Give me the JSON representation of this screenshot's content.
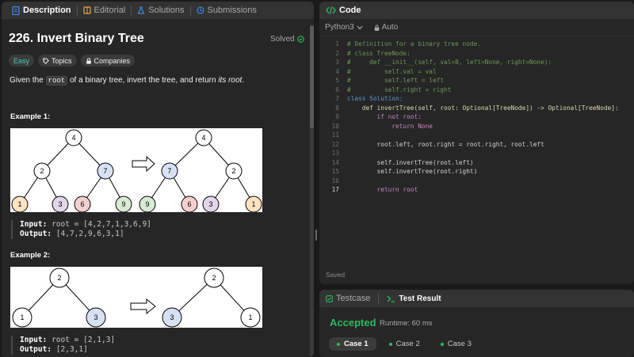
{
  "tabs": {
    "description": "Description",
    "editorial": "Editorial",
    "solutions": "Solutions",
    "submissions": "Submissions"
  },
  "problem": {
    "title": "226. Invert Binary Tree",
    "status": "Solved",
    "difficulty": "Easy",
    "topics": "Topics",
    "companies": "Companies",
    "desc_pre": "Given the ",
    "desc_code": "root",
    "desc_mid": " of a binary tree, invert the tree, and return ",
    "desc_em": "its root",
    "desc_post": "."
  },
  "examples": [
    {
      "title": "Example 1:",
      "input_label": "Input:",
      "input_value": "root = [4,2,7,1,3,6,9]",
      "output_label": "Output:",
      "output_value": "[4,7,2,9,6,3,1]",
      "tree_before": [
        "4",
        "2",
        "7",
        "1",
        "3",
        "6",
        "9"
      ],
      "tree_after": [
        "4",
        "7",
        "2",
        "9",
        "6",
        "3",
        "1"
      ]
    },
    {
      "title": "Example 2:",
      "input_label": "Input:",
      "input_value": "root = [2,1,3]",
      "output_label": "Output:",
      "output_value": "[2,3,1]",
      "tree_before": [
        "2",
        "1",
        "3"
      ],
      "tree_after": [
        "2",
        "3",
        "1"
      ]
    }
  ],
  "editor": {
    "title": "Code",
    "language": "Python3",
    "mode": "Auto",
    "status": "Saved",
    "lines": [
      "# Definition for a binary tree node.",
      "# class TreeNode:",
      "#     def __init__(self, val=0, left=None, right=None):",
      "#         self.val = val",
      "#         self.left = left",
      "#         self.right = right",
      "class Solution:",
      "    def invertTree(self, root: Optional[TreeNode]) -> Optional[TreeNode]:",
      "        if not root:",
      "            return None",
      "",
      "        root.left, root.right = root.right, root.left",
      "",
      "        self.invertTree(root.left)",
      "        self.invertTree(root.right)",
      "",
      "        return root"
    ]
  },
  "results": {
    "testcase_tab": "Testcase",
    "result_tab": "Test Result",
    "verdict": "Accepted",
    "runtime": "Runtime: 60 ms",
    "cases": [
      "Case 1",
      "Case 2",
      "Case 3"
    ]
  },
  "colors": {
    "accent_green": "#2cbb5d",
    "easy": "#46c6c2",
    "node_orange": "#fde3c0",
    "node_purple": "#e3d5ea",
    "node_red": "#f6cfcf",
    "node_green": "#d8ebd3",
    "node_blue": "#d6e2f4"
  }
}
